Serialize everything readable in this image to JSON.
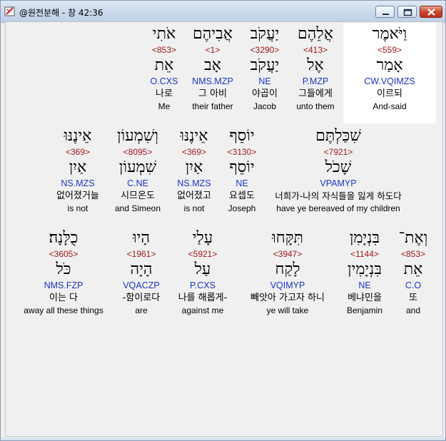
{
  "window": {
    "title": "@원전분해 - 창 42:36"
  },
  "rows": [
    [
      {
        "heb": "וַיֹּאמֶר",
        "num": "<559>",
        "root": "אָמַר",
        "code": "CW.VQIMZS",
        "kor": "이르되",
        "eng": "And-said",
        "highlight": true
      },
      {
        "heb": "אֲלֵהֶם",
        "num": "<413>",
        "root": "אֶל",
        "code": "P.MZP",
        "kor": "그들에게",
        "eng": "unto them"
      },
      {
        "heb": "יַעֲקֹב",
        "num": "<3290>",
        "root": "יַעֲקֹב",
        "code": "NE",
        "kor": "야곱이",
        "eng": "Jacob"
      },
      {
        "heb": "אֲבִיהֶם",
        "num": "<1>",
        "root": "אָב",
        "code": "NMS.MZP",
        "kor": "그 아비",
        "eng": "their father"
      },
      {
        "heb": "אֹתִי",
        "num": "<853>",
        "root": "אֵת",
        "code": "O.CXS",
        "kor": "나로",
        "eng": "Me"
      }
    ],
    [
      {
        "heb": "שִׁכַּלְתֶּם",
        "num": "<7921>",
        "root": "שָׁכֹל",
        "code": "VPAMYP",
        "kor": "너희가-나의 자식들을 잃게 하도다",
        "eng": "have ye bereaved of my children"
      },
      {
        "heb": "יוֹסֵף",
        "num": "<3130>",
        "root": "יוֹסֵף",
        "code": "NE",
        "kor": "요셉도",
        "eng": "Joseph"
      },
      {
        "heb": "אֵינֶנּוּ",
        "num": "<369>",
        "root": "אַיִן",
        "code": "NS.MZS",
        "kor": "없어졌고",
        "eng": "is not"
      },
      {
        "heb": "וְשִׁמְעוֹן",
        "num": "<8095>",
        "root": "שִׁמְעוֹן",
        "code": "C.NE",
        "kor": "시므온도",
        "eng": "and Simeon"
      },
      {
        "heb": "אֵינֶנּוּ",
        "num": "<369>",
        "root": "אַיִן",
        "code": "NS.MZS",
        "kor": "없어졌거늘",
        "eng": "is not"
      }
    ],
    [
      {
        "heb": "וְאֶת־",
        "num": "<853>",
        "root": "אֵת",
        "code": "C.O",
        "kor": "또",
        "eng": "and"
      },
      {
        "heb": "בִּנְיָמִן",
        "num": "<1144>",
        "root": "בִּנְיָמִין",
        "code": "NE",
        "kor": "베냐민을",
        "eng": "Benjamin"
      },
      {
        "heb": "תִּקָּחוּ",
        "num": "<3947>",
        "root": "לָקַח",
        "code": "VQIMYP",
        "kor": "빼앗아 가고자 하니",
        "eng": "ye will take"
      },
      {
        "heb": "עָלַי",
        "num": "<5921>",
        "root": "עַל",
        "code": "P.CXS",
        "kor": "나를 해롭게-",
        "eng": "against me"
      },
      {
        "heb": "הָיוּ",
        "num": "<1961>",
        "root": "הָיָה",
        "code": "VQACZP",
        "kor": "-함이로다",
        "eng": "are"
      },
      {
        "heb": "כֻלָּנָה׃",
        "num": "<3605>",
        "root": "כֹּל",
        "code": "NMS.FZP",
        "kor": "이는 다",
        "eng": "away all these things"
      }
    ]
  ]
}
